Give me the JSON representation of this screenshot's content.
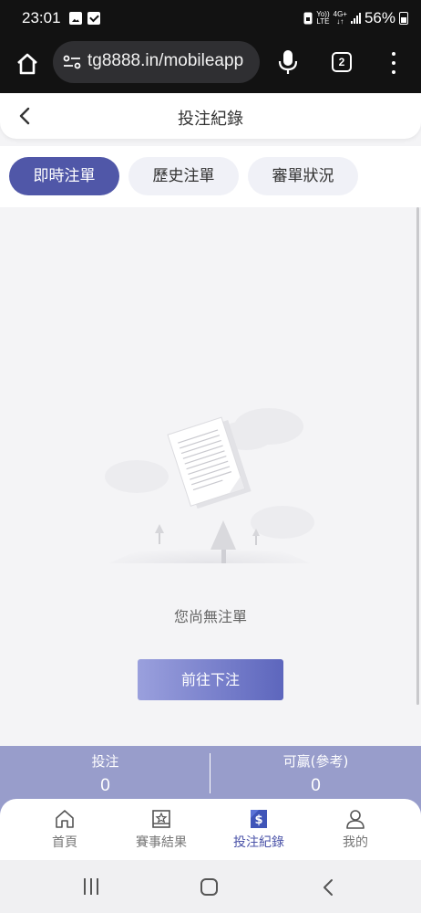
{
  "status_bar": {
    "time": "23:01",
    "net_top": "Yo))",
    "net_bottom": "LTE",
    "gen_top": "4G+",
    "gen_bottom": "↓↑",
    "battery": "56%"
  },
  "browser": {
    "url": "tg8888.in/mobileapp",
    "tab_count": "2"
  },
  "header": {
    "title": "投注紀錄"
  },
  "tabs": [
    {
      "label": "即時注單",
      "active": true
    },
    {
      "label": "歷史注單",
      "active": false
    },
    {
      "label": "審單狀況",
      "active": false
    }
  ],
  "empty_state": {
    "message": "您尚無注單",
    "button_label": "前往下注"
  },
  "summary": {
    "bet_label": "投注",
    "bet_value": "0",
    "win_label": "可贏(參考)",
    "win_value": "0"
  },
  "bottom_nav": [
    {
      "label": "首頁",
      "icon": "home-icon"
    },
    {
      "label": "賽事結果",
      "icon": "star-book-icon"
    },
    {
      "label": "投注紀錄",
      "icon": "dollar-doc-icon",
      "active": true
    },
    {
      "label": "我的",
      "icon": "user-icon"
    }
  ],
  "colors": {
    "accent": "#5057a8",
    "summary_bg": "#989dcb",
    "cta_start": "#9aa0dd",
    "cta_end": "#5d66bd"
  }
}
